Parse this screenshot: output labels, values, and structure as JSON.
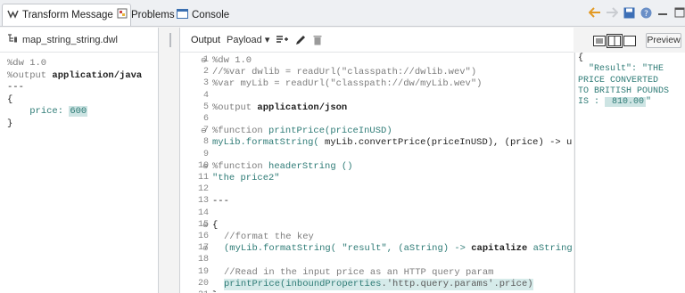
{
  "tabs": [
    {
      "label": "Transform Message",
      "close": "✕"
    },
    {
      "label": "Problems"
    },
    {
      "label": "Console"
    }
  ],
  "left_panel": {
    "file_name": "map_string_string.dwl",
    "lines": {
      "l1": "%dw 1.0",
      "l2a": "%output ",
      "l2b": "application/java",
      "l3": "---",
      "l4": "{",
      "l5a": "price: ",
      "l5b": "600",
      "l6": "}"
    }
  },
  "editor": {
    "toolbar": {
      "output_label": "Output",
      "payload_select": "Payload ▾"
    },
    "line_numbers": [
      "1",
      "2",
      "3",
      "4",
      "5",
      "6",
      "7",
      "8",
      "9",
      "10",
      "11",
      "12",
      "13",
      "14",
      "15",
      "16",
      "17",
      "18",
      "19",
      "20",
      "21"
    ],
    "code": {
      "l1": "%dw 1.0",
      "l2": "//%var dwlib = readUrl(\"classpath://dwlib.wev\")",
      "l3": "%var myLib = readUrl(\"classpath://dw/myLib.wev\")",
      "l5a": "%output ",
      "l5b": "application/json",
      "l7a": "%function ",
      "l7b": "printPrice(priceInUSD)",
      "l8a": "myLib.formatString( ",
      "l8b": "myLib.convertPrice(priceInUSD), (price) -> upper",
      "l10a": "%function ",
      "l10b": "headerString ()",
      "l11": "\"the price2\"",
      "l13": "---",
      "l15": "{",
      "l16": "//format the key",
      "l17a": "(myLib.formatString( \"result\", (aString) -> ",
      "l17b": "capitalize",
      "l17c": " aString ))",
      "l19": "//Read in the input price as an HTTP query param",
      "l20a": "printPrice(",
      "l20b": "inboundProperties",
      "l20c": ".'http.query.params'.price)",
      "l21": "}"
    }
  },
  "right_panel": {
    "preview_label": "Preview",
    "output_lines": {
      "o1": "{",
      "o2": "  \"Result\": \"THE",
      "o3": "PRICE CONVERTED",
      "o4": "TO BRITISH POUNDS",
      "o5": "IS : ",
      "o5b": " 810.00",
      "o5c": "\""
    }
  },
  "colors": {
    "accent_teal": "#2e7b76",
    "highlight": "#d6ebea"
  }
}
